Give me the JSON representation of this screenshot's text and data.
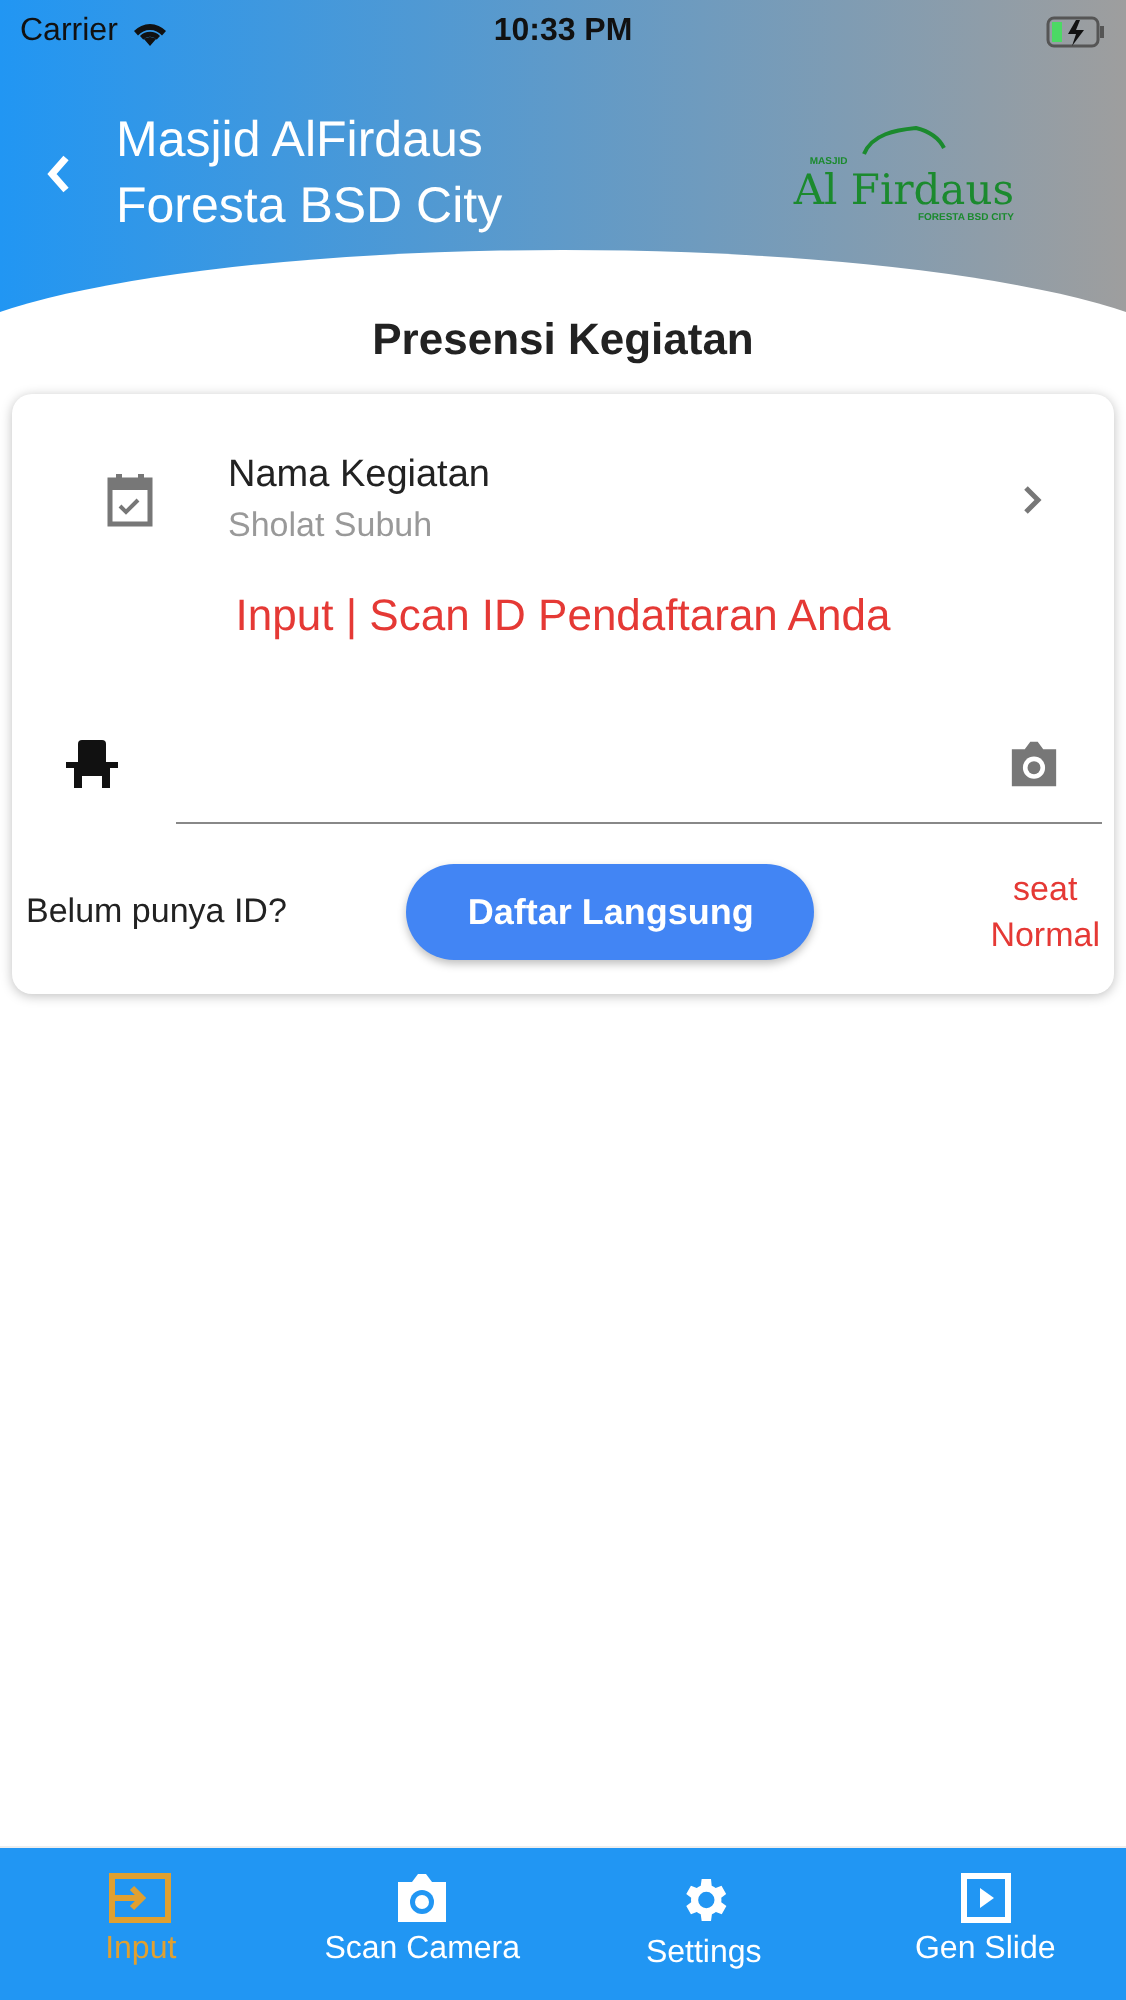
{
  "status_bar": {
    "carrier": "Carrier",
    "time": "10:33 PM"
  },
  "header": {
    "title_lines": [
      "Masjid AlFirdaus",
      "Foresta BSD City"
    ],
    "logo": {
      "top": "MASJID",
      "name": "Al Firdaus",
      "bottom": "FORESTA BSD CITY"
    }
  },
  "page_title": "Presensi Kegiatan",
  "activity": {
    "label": "Nama Kegiatan",
    "value": "Sholat Subuh"
  },
  "prompt": "Input | Scan ID Pendaftaran Anda",
  "no_id_text": "Belum punya ID?",
  "register_button": "Daftar Langsung",
  "seat_type": [
    "seat",
    "Normal"
  ],
  "bottom_nav": [
    {
      "kind": "input",
      "label": "Input",
      "selected": true
    },
    {
      "kind": "camera",
      "label": "Scan Camera",
      "selected": false
    },
    {
      "kind": "settings",
      "label": "Settings",
      "selected": false
    },
    {
      "kind": "slide",
      "label": "Gen Slide",
      "selected": false
    }
  ]
}
